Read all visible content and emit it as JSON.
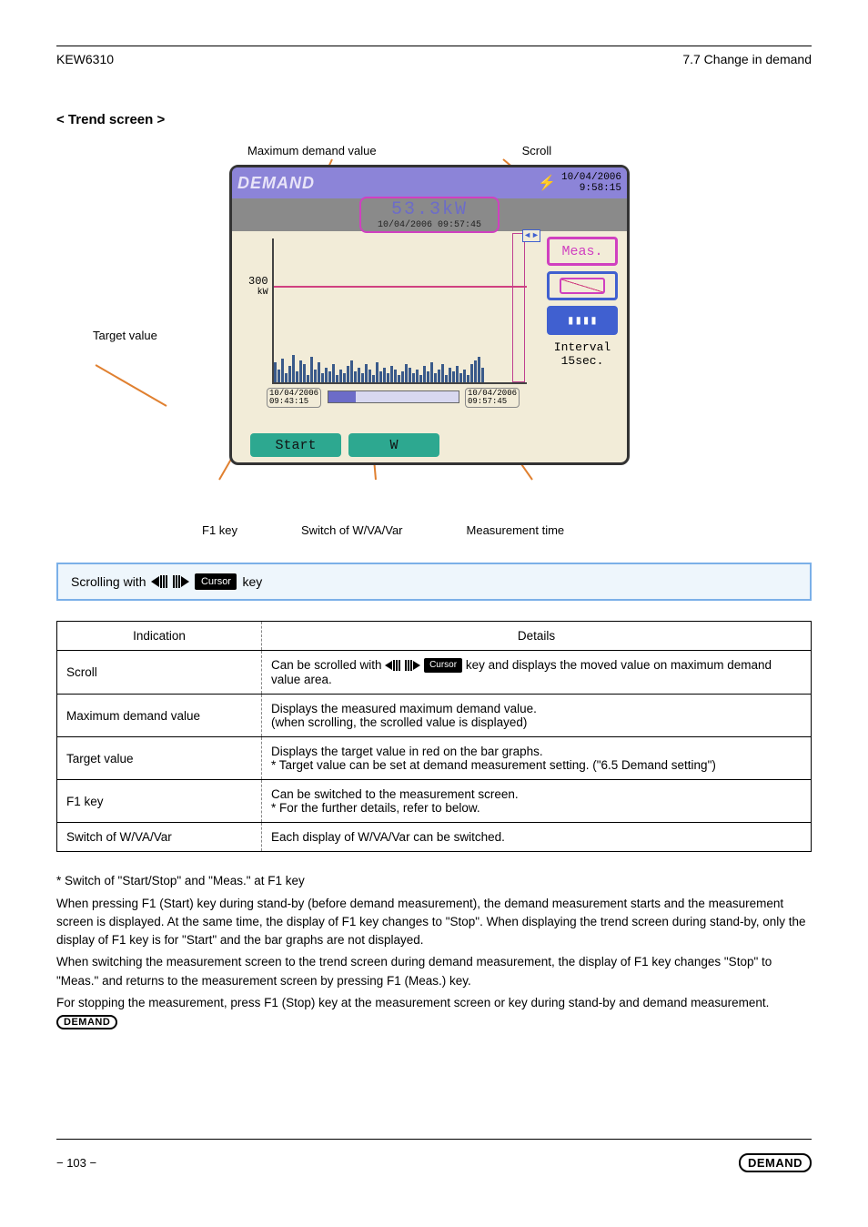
{
  "header": {
    "left": "KEW6310",
    "right": "7.7 Change in demand"
  },
  "section_title": "< Trend screen >",
  "top_labels": {
    "a": "Maximum demand value",
    "b": "Scroll"
  },
  "device": {
    "logo": "DEMAND",
    "clock_date": "10/04/2006",
    "clock_time": "9:58:15",
    "readout_value": "53.3kW",
    "readout_time": "10/04/2006 09:57:45",
    "y_axis_value": "300",
    "y_axis_unit": "kW",
    "btn_meas": "Meas.",
    "interval_label": "Interval",
    "interval_value": "15sec.",
    "date_start": "10/04/2006",
    "time_start": "09:43:15",
    "date_end": "10/04/2006",
    "time_end": "09:57:45",
    "btn_start": "Start",
    "btn_w": "W"
  },
  "bottom_labels": {
    "a": "Target value",
    "b": "F1 key",
    "c": "Switch of W/VA/Var",
    "d": "Measurement time"
  },
  "info_text_before": "Scrolling with",
  "info_text_after": "key",
  "cursor_key_label": "Cursor",
  "table": {
    "head_indication": "Indication",
    "head_details": "Details",
    "rows": [
      {
        "c1": "Scroll",
        "c2_pre": "Can be scrolled with ",
        "c2_mid": " ",
        "c2_key": "Cursor",
        "c2_post": " key and displays the moved value\non maximum demand value area."
      },
      {
        "c1": "Maximum demand value",
        "c2": "Displays the measured maximum demand value.\n(when scrolling, the scrolled value is displayed)"
      },
      {
        "c1": "Target value",
        "c2": "Displays the target value in red on the bar graphs.\n* Target value can be set at demand measurement setting. (\"6.5 Demand setting\")"
      },
      {
        "c1": "F1 key",
        "c2": "Can be switched to the measurement screen.\n* For the further details, refer to below."
      },
      {
        "c1": "Switch of W/VA/Var",
        "c2": "Each display of W/VA/Var can be switched."
      }
    ]
  },
  "paragraphs": [
    "* Switch of \"Start/Stop\" and \"Meas.\" at F1 key",
    "When pressing F1 (Start) key during stand-by (before demand measurement), the demand measurement starts and the measurement screen is displayed. At the same time, the display of F1 key changes to \"Stop\". When displaying the trend screen during stand-by, only the display of F1 key is for \"Start\" and the bar graphs are not displayed.",
    "When switching the measurement screen to the trend screen during demand measurement, the display of F1 key changes \"Stop\" to \"Meas.\" and returns to the measurement screen by pressing F1 (Meas.) key.",
    "For stopping the measurement, press F1 (Stop) key at the measurement screen or         key during stand-by and demand measurement."
  ],
  "footer": {
    "left": "− 103 −",
    "right_label": "DEMAND"
  }
}
